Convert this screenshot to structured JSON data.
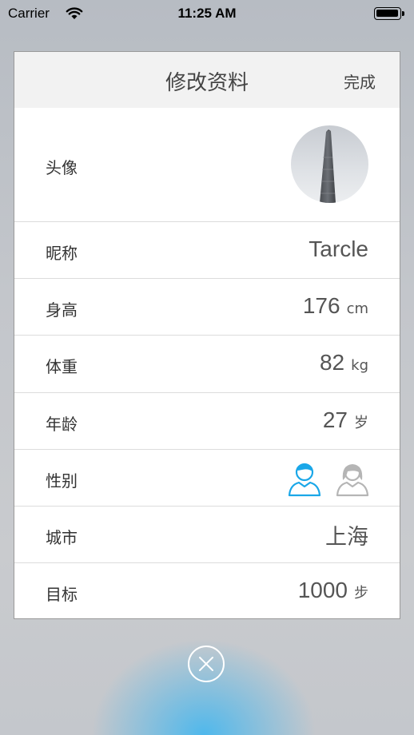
{
  "status_bar": {
    "carrier": "Carrier",
    "time": "11:25 AM"
  },
  "dialog": {
    "title": "修改资料",
    "done_label": "完成",
    "rows": {
      "avatar": {
        "label": "头像"
      },
      "nickname": {
        "label": "昵称",
        "value": "Tarcle"
      },
      "height": {
        "label": "身高",
        "value": "176",
        "unit": "cm"
      },
      "weight": {
        "label": "体重",
        "value": "82",
        "unit": "kg"
      },
      "age": {
        "label": "年龄",
        "value": "27",
        "unit": "岁"
      },
      "gender": {
        "label": "性别",
        "selected": "male",
        "male_color": "#1aa7e8",
        "female_color": "#b5b5b5"
      },
      "city": {
        "label": "城市",
        "value": "上海"
      },
      "goal": {
        "label": "目标",
        "value": "1000",
        "unit": "步"
      }
    }
  },
  "icons": [
    "wifi-icon",
    "battery-icon",
    "male-user-icon",
    "female-user-icon",
    "close-icon"
  ],
  "colors": {
    "accent": "#1aa7e8",
    "card_header_bg": "#f2f2f2"
  }
}
